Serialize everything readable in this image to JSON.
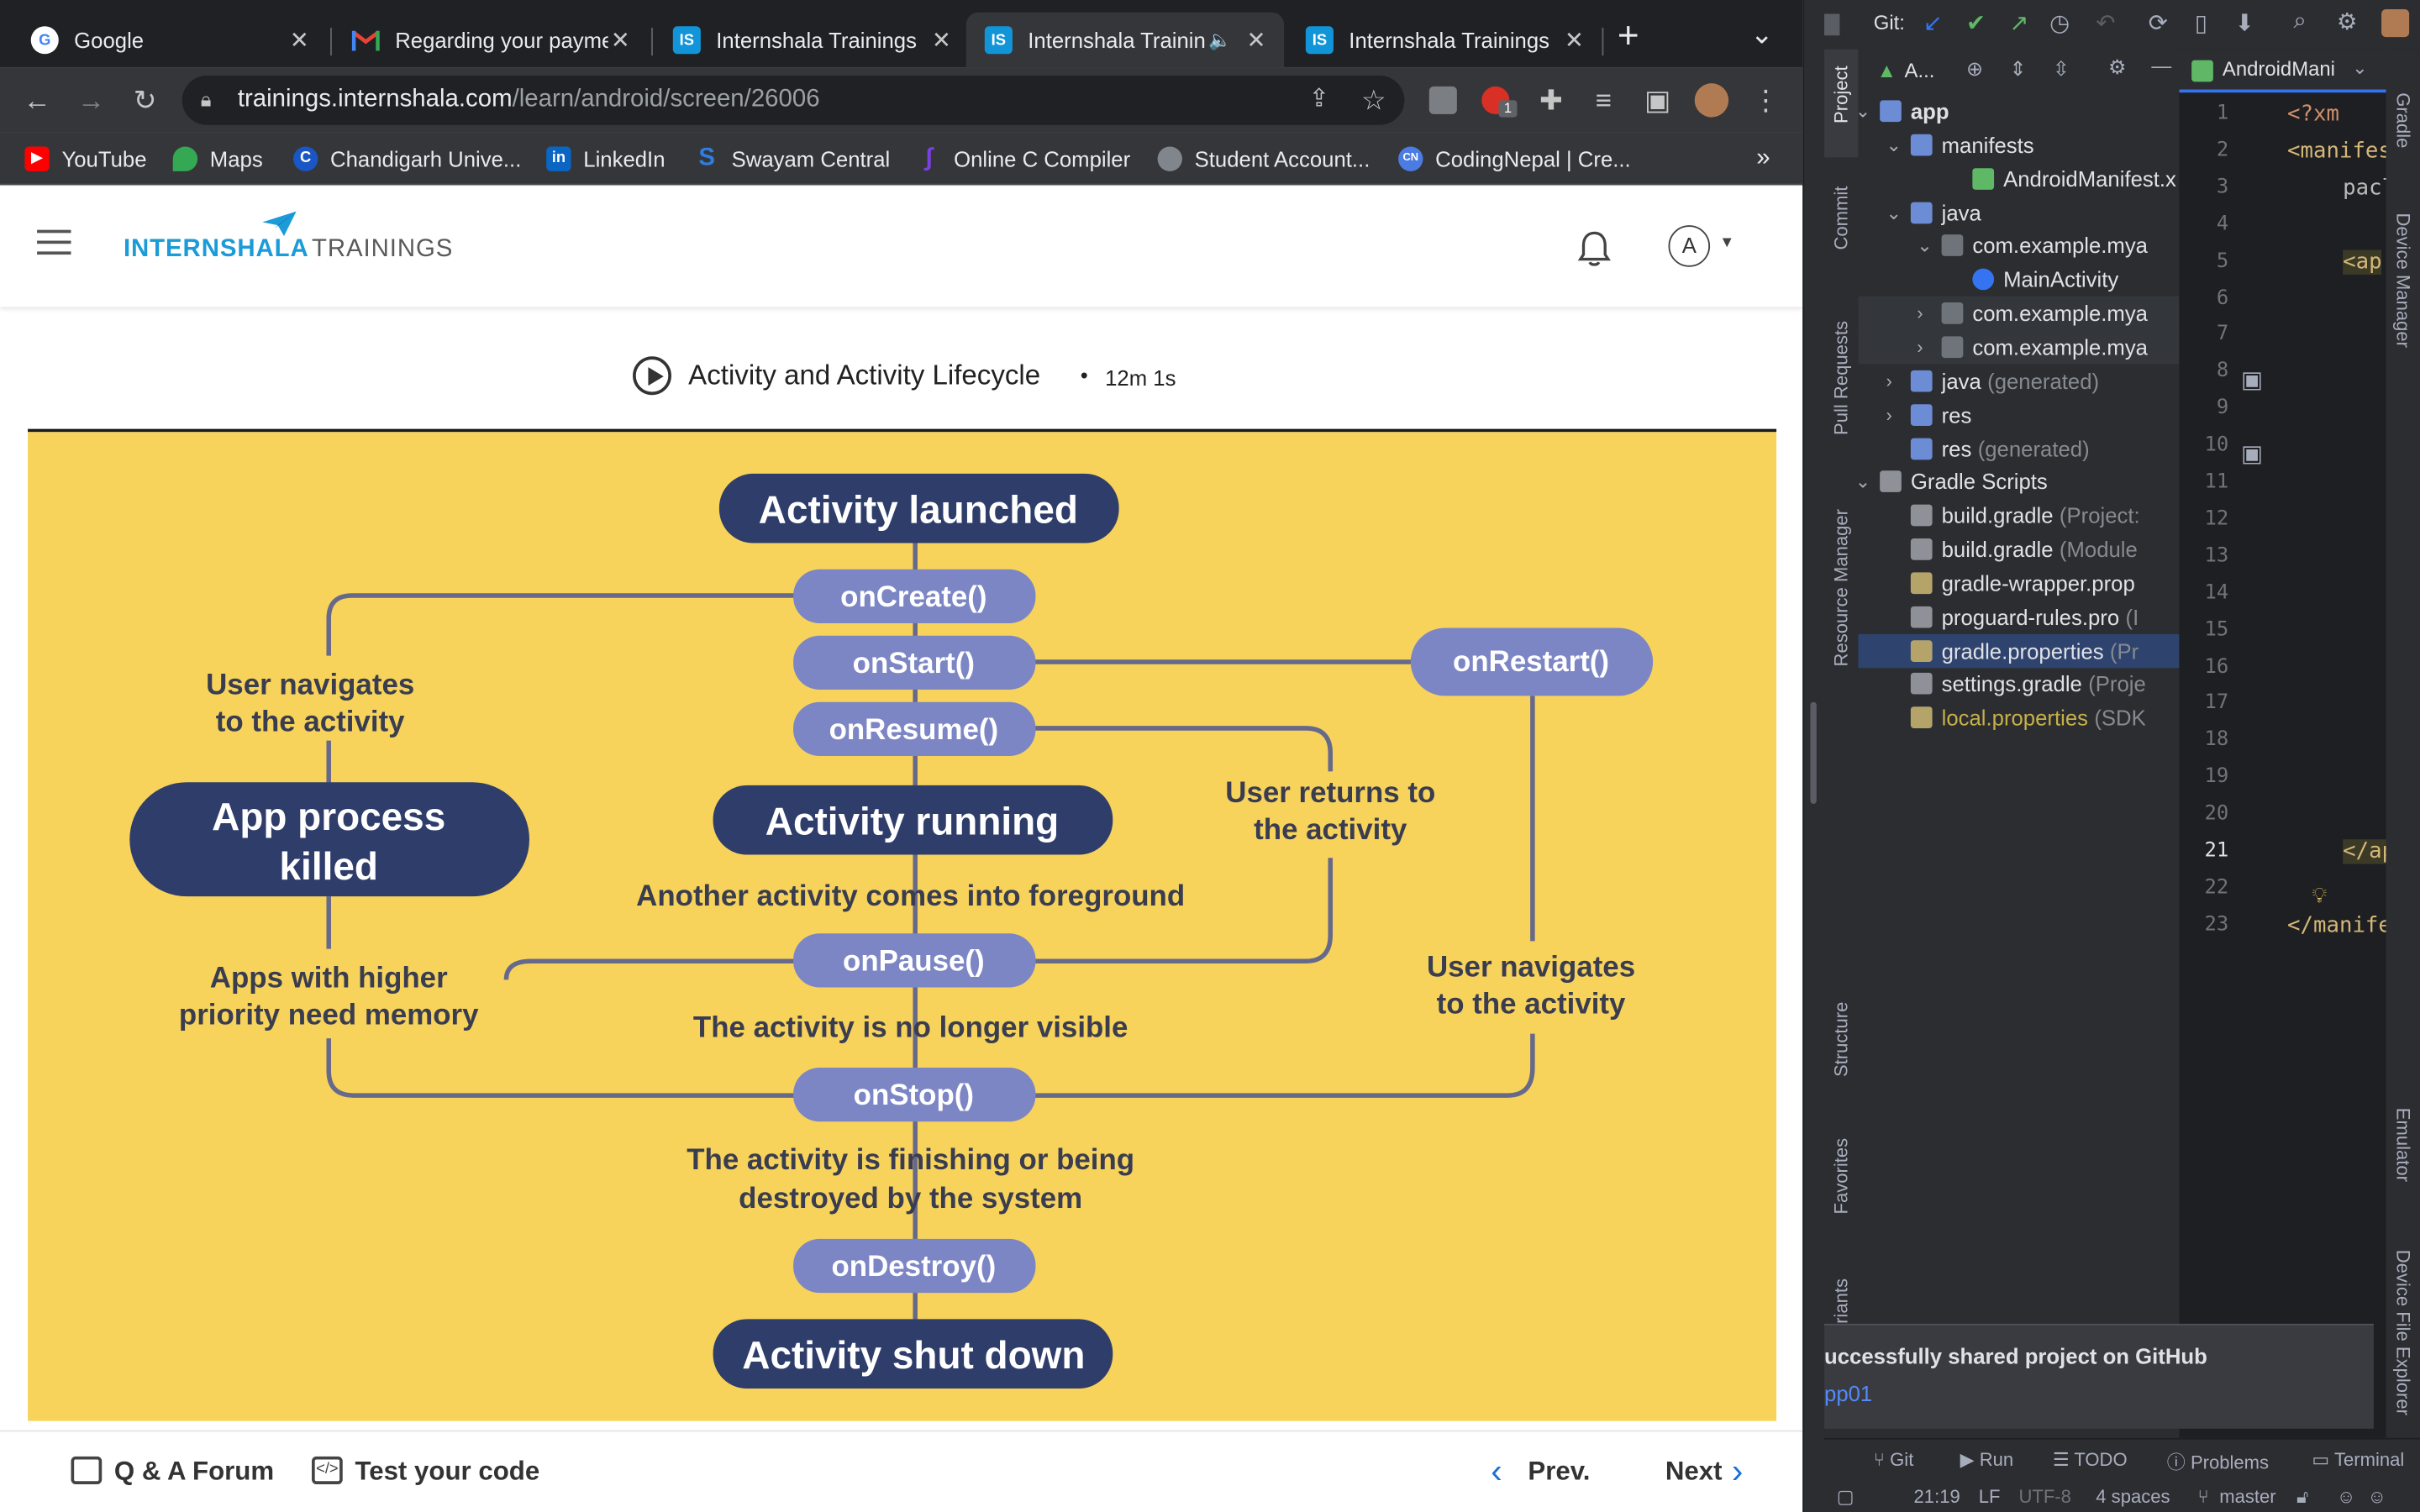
{
  "browser": {
    "tabs": [
      {
        "title": "Google",
        "favicon": "google-icon"
      },
      {
        "title": "Regarding your payme",
        "favicon": "gmail-icon"
      },
      {
        "title": "Internshala Trainings",
        "favicon": "internshala-icon"
      },
      {
        "title": "Internshala Trainin",
        "favicon": "internshala-icon"
      },
      {
        "title": "Internshala Trainings",
        "favicon": "internshala-icon"
      }
    ],
    "new_tab": "+",
    "tab_menu": "⌄",
    "url_host": "trainings.internshala.com",
    "url_path": "/learn/android/screen/26006",
    "bookmarks": [
      "YouTube",
      "Maps",
      "Chandigarh Unive...",
      "LinkedIn",
      "Swayam Central",
      "Online C Compiler",
      "Student Account...",
      "CodingNepal | Cre..."
    ],
    "bookmarks_more": "»",
    "extension_badge": "1"
  },
  "site": {
    "logo_primary": "INTERNSHALA",
    "logo_secondary": "TRAININGS",
    "avatar_letter": "A",
    "lesson_title": "Activity and Activity Lifecycle",
    "lesson_duration": "12m 1s",
    "footer": {
      "forum": "Q & A Forum",
      "test": "Test your code",
      "prev": "Prev.",
      "next": "Next"
    }
  },
  "diagram": {
    "activity_launched": "Activity launched",
    "on_create": "onCreate()",
    "on_start": "onStart()",
    "on_resume": "onResume()",
    "on_restart": "onRestart()",
    "activity_running": "Activity running",
    "on_pause": "onPause()",
    "on_stop": "onStop()",
    "on_destroy": "onDestroy()",
    "activity_shut_down": "Activity shut down",
    "app_process_killed_1": "App process",
    "app_process_killed_2": "killed",
    "user_navigates_left_1": "User navigates",
    "user_navigates_left_2": "to the activity",
    "user_returns_1": "User returns to",
    "user_returns_2": "the activity",
    "another_activity": "Another activity comes into foreground",
    "apps_higher_1": "Apps with higher",
    "apps_higher_2": "priority need memory",
    "no_longer_visible": "The activity is no longer visible",
    "user_navigates_right_1": "User navigates",
    "user_navigates_right_2": "to the activity",
    "finishing_1": "The activity is finishing or being",
    "finishing_2": "destroyed by the system",
    "colors": {
      "dark": "#2f3d6b",
      "light": "#7d86c5",
      "line": "#67698a",
      "background": "#f7d35c"
    }
  },
  "ide": {
    "git_label": "Git:",
    "project_selector": "A...",
    "editor_tab": "AndroidMani",
    "left_tools": [
      "Project",
      "Commit",
      "Pull Requests",
      "Resource Manager",
      "Structure",
      "Favorites",
      "riants"
    ],
    "right_tools": [
      "Gradle",
      "Device Manager",
      "Emulator",
      "Device File Explorer"
    ],
    "tree": [
      {
        "label": "app",
        "extra": "",
        "depth": 0,
        "chev": "v",
        "icon": "folder",
        "bold": true
      },
      {
        "label": "manifests",
        "extra": "",
        "depth": 1,
        "chev": "v",
        "icon": "folder"
      },
      {
        "label": "AndroidManifest.x",
        "extra": "",
        "depth": 3,
        "chev": "",
        "icon": "manifest"
      },
      {
        "label": "java",
        "extra": "",
        "depth": 1,
        "chev": "v",
        "icon": "folder"
      },
      {
        "label": "com.example.mya",
        "extra": "",
        "depth": 2,
        "chev": "v",
        "icon": "package"
      },
      {
        "label": "MainActivity",
        "extra": "",
        "depth": 3,
        "chev": "",
        "icon": "class"
      },
      {
        "label": "com.example.mya",
        "extra": "",
        "depth": 2,
        "chev": ">",
        "icon": "package",
        "hl": true
      },
      {
        "label": "com.example.mya",
        "extra": "",
        "depth": 2,
        "chev": ">",
        "icon": "package",
        "hl": true
      },
      {
        "label": "java",
        "extra": "(generated)",
        "depth": 1,
        "chev": ">",
        "icon": "folder"
      },
      {
        "label": "res",
        "extra": "",
        "depth": 1,
        "chev": ">",
        "icon": "folder"
      },
      {
        "label": "res",
        "extra": "(generated)",
        "depth": 1,
        "chev": "",
        "icon": "folder"
      },
      {
        "label": "Gradle Scripts",
        "extra": "",
        "depth": 0,
        "chev": "v",
        "icon": "gradle"
      },
      {
        "label": "build.gradle",
        "extra": "(Project:",
        "depth": 1,
        "chev": "",
        "icon": "gradle"
      },
      {
        "label": "build.gradle",
        "extra": "(Module",
        "depth": 1,
        "chev": "",
        "icon": "gradle"
      },
      {
        "label": "gradle-wrapper.prop",
        "extra": "",
        "depth": 1,
        "chev": "",
        "icon": "props"
      },
      {
        "label": "proguard-rules.pro",
        "extra": "(I",
        "depth": 1,
        "chev": "",
        "icon": "file"
      },
      {
        "label": "gradle.properties",
        "extra": "(Pr",
        "depth": 1,
        "chev": "",
        "icon": "props",
        "selected": true
      },
      {
        "label": "settings.gradle",
        "extra": "(Proje",
        "depth": 1,
        "chev": "",
        "icon": "gradle"
      },
      {
        "label": "local.properties",
        "extra": "(SDK",
        "depth": 1,
        "chev": "",
        "icon": "props",
        "yellow": true
      }
    ],
    "line_numbers": [
      "1",
      "2",
      "3",
      "4",
      "5",
      "6",
      "7",
      "8",
      "9",
      "10",
      "11",
      "12",
      "13",
      "14",
      "15",
      "16",
      "17",
      "18",
      "19",
      "20",
      "21",
      "22",
      "23"
    ],
    "code": [
      {
        "line": 1,
        "text": "<?xm",
        "color": "#cf8e6d"
      },
      {
        "line": 2,
        "text": "<manifes",
        "color": "#d5b778"
      },
      {
        "line": 3,
        "text": "pacl",
        "color": "#bababa",
        "indent": true
      },
      {
        "line": 5,
        "text": "<ap",
        "color": "#d5b778",
        "indent": true,
        "hl": true
      },
      {
        "line": 21,
        "text": "</ap",
        "color": "#d5b778",
        "indent": true,
        "hl": true
      },
      {
        "line": 23,
        "text": "</manife",
        "color": "#d5b778"
      }
    ],
    "toast_title": "uccessfully shared project on GitHub",
    "toast_link": "pp01",
    "status_tools": [
      "Git",
      "Run",
      "TODO",
      "Problems",
      "Terminal"
    ],
    "status_info": {
      "pos": "21:19",
      "eol": "LF",
      "enc": "UTF-8",
      "indent": "4 spaces",
      "branch": "master"
    }
  }
}
